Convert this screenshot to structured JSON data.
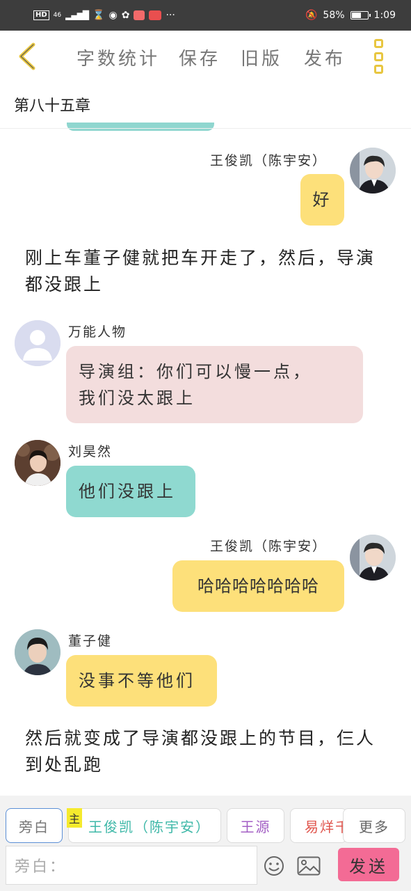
{
  "status_bar": {
    "hd": "HD",
    "network": "46",
    "battery_text": "58%",
    "battery_level": 0.58,
    "time": "1:09",
    "more": "···"
  },
  "toolbar": {
    "word_count": "字数统计",
    "save": "保存",
    "old_version": "旧版",
    "publish": "发布"
  },
  "chapter_title": "第八十五章",
  "messages": [
    {
      "speaker": "王俊凯（陈宇安）",
      "text": "好"
    },
    {
      "narration": "刚上车董子健就把车开走了，然后，导演都没跟上"
    },
    {
      "speaker": "万能人物",
      "lines": [
        "导演组：你们可以慢一点，",
        "我们没太跟上"
      ]
    },
    {
      "speaker": "刘昊然",
      "text": "他们没跟上"
    },
    {
      "speaker": "王俊凯（陈宇安）",
      "text": "哈哈哈哈哈哈哈"
    },
    {
      "speaker": "董子健",
      "text": "没事不等他们"
    },
    {
      "narration": "然后就变成了导演都没跟上的节目，仨人到处乱跑"
    }
  ],
  "role_bar": {
    "narrator": "旁白",
    "main_tag": "主",
    "main_role": "王俊凯（陈宇安）",
    "role_wangyuan": "王源",
    "role_yiyang": "易烊千",
    "more": "更多"
  },
  "input_placeholder": "旁白：",
  "send_label": "发送",
  "colors": {
    "accent_yellow": "#fde07a",
    "teal": "#8fd9d0",
    "pink_bubble": "#f3dddd",
    "send_pink": "#f36b95",
    "icon_gold": "#e8c640"
  }
}
